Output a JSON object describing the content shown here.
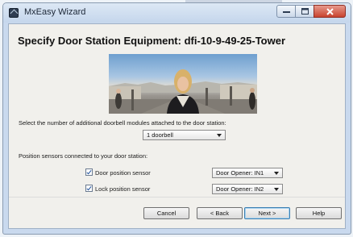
{
  "window": {
    "title": "MxEasy Wizard",
    "controls": [
      "minimize",
      "maximize",
      "close"
    ]
  },
  "page": {
    "heading": "Specify Door Station Equipment: dfi-10-9-49-25-Tower"
  },
  "camera_image": {
    "description_icon": "camera-preview-image"
  },
  "doorbell": {
    "prompt": "Select the number of additional doorbell modules attached to the door station:",
    "selected": "1 doorbell"
  },
  "sensors": {
    "prompt": "Position sensors connected to your door station:",
    "items": [
      {
        "label": "Door position sensor",
        "checked": true,
        "input": "Door Opener: IN1"
      },
      {
        "label": "Lock position sensor",
        "checked": true,
        "input": "Door Opener: IN2"
      }
    ]
  },
  "buttons": {
    "cancel": "Cancel",
    "back": "< Back",
    "next": "Next >",
    "help": "Help"
  },
  "colors": {
    "title_bar": "#c5d6ec",
    "close_button": "#c8432f",
    "dialog_bg": "#f1f0ec"
  }
}
